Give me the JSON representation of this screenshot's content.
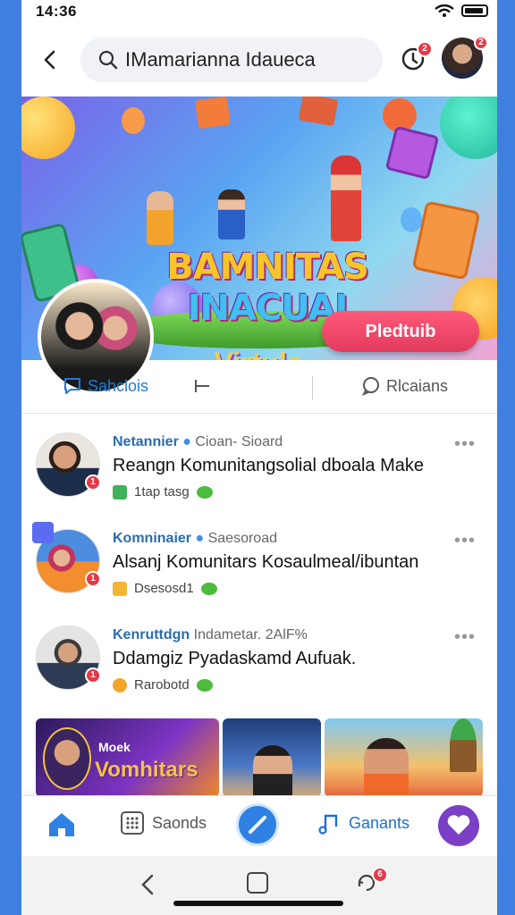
{
  "status_bar": {
    "time": "14:36"
  },
  "header": {
    "search_text": "IMamarianna Idaueca",
    "notification_badge": "2",
    "profile_badge": "2"
  },
  "banner": {
    "title_line1": "BAMNITAS",
    "title_line2": "INACUAJ",
    "subtitle": "Virtuls",
    "play_button": "Pledtuib"
  },
  "tabs": [
    {
      "label": "Sahclois"
    },
    {
      "label": ""
    },
    {
      "label": "Rlcaians"
    }
  ],
  "posts": [
    {
      "name": "Netannier",
      "meta": "Cioan- Sioard",
      "text": "Reangn Komunitangsolial dboala Make",
      "sub": "1tap tasg",
      "badge": "1"
    },
    {
      "name": "Komninaier",
      "meta": "Saesoroad",
      "text": "Alsanj Komunitars Kosaulmeal/ibuntan",
      "sub": "Dsesosd1",
      "badge": "1"
    },
    {
      "name": "Kenruttdgn",
      "meta": "Indametar. 2AlF%",
      "text": "Ddamgiz Pyadaskamd Aufuak.",
      "sub": "Rarobotd",
      "badge": "1"
    }
  ],
  "thumbnails": {
    "label": "Moek",
    "title": "Vomhitars"
  },
  "bottom_nav": {
    "item2": "Saonds",
    "item4": "Ganants"
  },
  "system_bar": {
    "badge": "6"
  }
}
